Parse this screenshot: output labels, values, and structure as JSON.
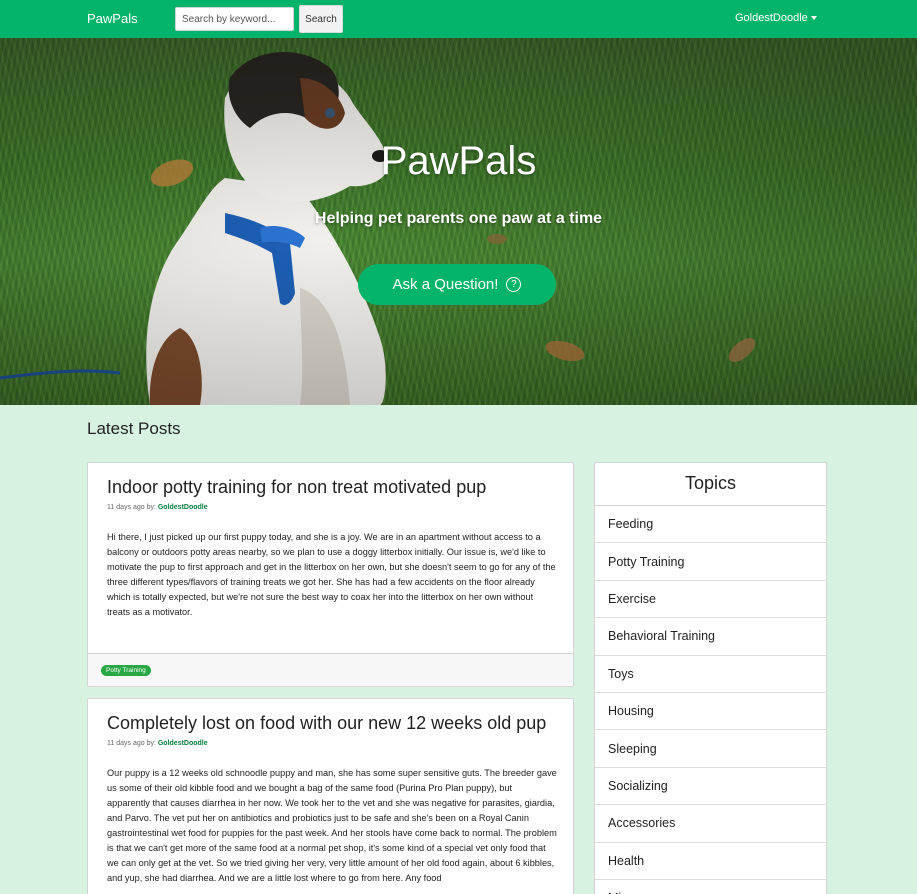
{
  "navbar": {
    "brand": "PawPals",
    "search_placeholder": "Search by keyword...",
    "search_button": "Search",
    "username": "GoldestDoodle"
  },
  "hero": {
    "title": "PawPals",
    "subtitle": "Helping pet parents one paw at a time",
    "ask_button": "Ask a Question!",
    "ask_icon": "question-circle-icon"
  },
  "main": {
    "section_title": "Latest Posts",
    "posts": [
      {
        "title": "Indoor potty training for non treat motivated pup",
        "meta_prefix": "11 days ago by:",
        "author": "GoldestDoodle",
        "body": "Hi there, I just picked up our first puppy today, and she is a joy. We are in an apartment without access to a balcony or outdoors potty areas nearby, so we plan to use a doggy litterbox initially. Our issue is, we'd like to motivate the pup to first approach and get in the litterbox on her own, but she doesn't seem to go for any of the three different types/flavors of training treats we got her. She has had a few accidents on the floor already which is totally expected, but we're not sure the best way to coax her into the litterbox on her own without treats as a motivator.",
        "tag": "Potty Training"
      },
      {
        "title": "Completely lost on food with our new 12 weeks old pup",
        "meta_prefix": "11 days ago by:",
        "author": "GoldestDoodle",
        "body": "Our puppy is a 12 weeks old schnoodle puppy and man, she has some super sensitive guts. The breeder gave us some of their old kibble food and we bought a bag of the same food (Purina Pro Plan puppy), but apparently that causes diarrhea in her now. We took her to the vet and she was negative for parasites, giardia, and Parvo. The vet put her on antibiotics and probiotics just to be safe and she's been on a Royal Canin gastrointestinal wet food for puppies for the past week. And her stools have come back to normal. The problem is that we can't get more of the same food at a normal pet shop, it's some kind of a special vet only food that we can only get at the vet. So we tried giving her very, very little amount of her old food again, about 6 kibbles, and yup, she had diarrhea. And we are a little lost where to go from here. Any food"
      }
    ]
  },
  "topics": {
    "title": "Topics",
    "items": [
      "Feeding",
      "Potty Training",
      "Exercise",
      "Behavioral Training",
      "Toys",
      "Housing",
      "Sleeping",
      "Socializing",
      "Accessories",
      "Health",
      "Misc"
    ]
  },
  "colors": {
    "brand_green": "#03b46a",
    "page_background": "#d8f2e1",
    "tag_green": "#28a745"
  }
}
